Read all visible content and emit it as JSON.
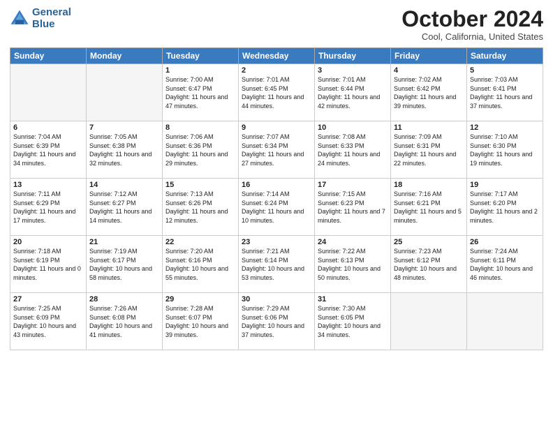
{
  "header": {
    "logo_line1": "General",
    "logo_line2": "Blue",
    "month_title": "October 2024",
    "subtitle": "Cool, California, United States"
  },
  "days_of_week": [
    "Sunday",
    "Monday",
    "Tuesday",
    "Wednesday",
    "Thursday",
    "Friday",
    "Saturday"
  ],
  "weeks": [
    [
      {
        "day": "",
        "sunrise": "",
        "sunset": "",
        "daylight": "",
        "empty": true
      },
      {
        "day": "",
        "sunrise": "",
        "sunset": "",
        "daylight": "",
        "empty": true
      },
      {
        "day": "1",
        "sunrise": "Sunrise: 7:00 AM",
        "sunset": "Sunset: 6:47 PM",
        "daylight": "Daylight: 11 hours and 47 minutes.",
        "empty": false
      },
      {
        "day": "2",
        "sunrise": "Sunrise: 7:01 AM",
        "sunset": "Sunset: 6:45 PM",
        "daylight": "Daylight: 11 hours and 44 minutes.",
        "empty": false
      },
      {
        "day": "3",
        "sunrise": "Sunrise: 7:01 AM",
        "sunset": "Sunset: 6:44 PM",
        "daylight": "Daylight: 11 hours and 42 minutes.",
        "empty": false
      },
      {
        "day": "4",
        "sunrise": "Sunrise: 7:02 AM",
        "sunset": "Sunset: 6:42 PM",
        "daylight": "Daylight: 11 hours and 39 minutes.",
        "empty": false
      },
      {
        "day": "5",
        "sunrise": "Sunrise: 7:03 AM",
        "sunset": "Sunset: 6:41 PM",
        "daylight": "Daylight: 11 hours and 37 minutes.",
        "empty": false
      }
    ],
    [
      {
        "day": "6",
        "sunrise": "Sunrise: 7:04 AM",
        "sunset": "Sunset: 6:39 PM",
        "daylight": "Daylight: 11 hours and 34 minutes.",
        "empty": false
      },
      {
        "day": "7",
        "sunrise": "Sunrise: 7:05 AM",
        "sunset": "Sunset: 6:38 PM",
        "daylight": "Daylight: 11 hours and 32 minutes.",
        "empty": false
      },
      {
        "day": "8",
        "sunrise": "Sunrise: 7:06 AM",
        "sunset": "Sunset: 6:36 PM",
        "daylight": "Daylight: 11 hours and 29 minutes.",
        "empty": false
      },
      {
        "day": "9",
        "sunrise": "Sunrise: 7:07 AM",
        "sunset": "Sunset: 6:34 PM",
        "daylight": "Daylight: 11 hours and 27 minutes.",
        "empty": false
      },
      {
        "day": "10",
        "sunrise": "Sunrise: 7:08 AM",
        "sunset": "Sunset: 6:33 PM",
        "daylight": "Daylight: 11 hours and 24 minutes.",
        "empty": false
      },
      {
        "day": "11",
        "sunrise": "Sunrise: 7:09 AM",
        "sunset": "Sunset: 6:31 PM",
        "daylight": "Daylight: 11 hours and 22 minutes.",
        "empty": false
      },
      {
        "day": "12",
        "sunrise": "Sunrise: 7:10 AM",
        "sunset": "Sunset: 6:30 PM",
        "daylight": "Daylight: 11 hours and 19 minutes.",
        "empty": false
      }
    ],
    [
      {
        "day": "13",
        "sunrise": "Sunrise: 7:11 AM",
        "sunset": "Sunset: 6:29 PM",
        "daylight": "Daylight: 11 hours and 17 minutes.",
        "empty": false
      },
      {
        "day": "14",
        "sunrise": "Sunrise: 7:12 AM",
        "sunset": "Sunset: 6:27 PM",
        "daylight": "Daylight: 11 hours and 14 minutes.",
        "empty": false
      },
      {
        "day": "15",
        "sunrise": "Sunrise: 7:13 AM",
        "sunset": "Sunset: 6:26 PM",
        "daylight": "Daylight: 11 hours and 12 minutes.",
        "empty": false
      },
      {
        "day": "16",
        "sunrise": "Sunrise: 7:14 AM",
        "sunset": "Sunset: 6:24 PM",
        "daylight": "Daylight: 11 hours and 10 minutes.",
        "empty": false
      },
      {
        "day": "17",
        "sunrise": "Sunrise: 7:15 AM",
        "sunset": "Sunset: 6:23 PM",
        "daylight": "Daylight: 11 hours and 7 minutes.",
        "empty": false
      },
      {
        "day": "18",
        "sunrise": "Sunrise: 7:16 AM",
        "sunset": "Sunset: 6:21 PM",
        "daylight": "Daylight: 11 hours and 5 minutes.",
        "empty": false
      },
      {
        "day": "19",
        "sunrise": "Sunrise: 7:17 AM",
        "sunset": "Sunset: 6:20 PM",
        "daylight": "Daylight: 11 hours and 2 minutes.",
        "empty": false
      }
    ],
    [
      {
        "day": "20",
        "sunrise": "Sunrise: 7:18 AM",
        "sunset": "Sunset: 6:19 PM",
        "daylight": "Daylight: 11 hours and 0 minutes.",
        "empty": false
      },
      {
        "day": "21",
        "sunrise": "Sunrise: 7:19 AM",
        "sunset": "Sunset: 6:17 PM",
        "daylight": "Daylight: 10 hours and 58 minutes.",
        "empty": false
      },
      {
        "day": "22",
        "sunrise": "Sunrise: 7:20 AM",
        "sunset": "Sunset: 6:16 PM",
        "daylight": "Daylight: 10 hours and 55 minutes.",
        "empty": false
      },
      {
        "day": "23",
        "sunrise": "Sunrise: 7:21 AM",
        "sunset": "Sunset: 6:14 PM",
        "daylight": "Daylight: 10 hours and 53 minutes.",
        "empty": false
      },
      {
        "day": "24",
        "sunrise": "Sunrise: 7:22 AM",
        "sunset": "Sunset: 6:13 PM",
        "daylight": "Daylight: 10 hours and 50 minutes.",
        "empty": false
      },
      {
        "day": "25",
        "sunrise": "Sunrise: 7:23 AM",
        "sunset": "Sunset: 6:12 PM",
        "daylight": "Daylight: 10 hours and 48 minutes.",
        "empty": false
      },
      {
        "day": "26",
        "sunrise": "Sunrise: 7:24 AM",
        "sunset": "Sunset: 6:11 PM",
        "daylight": "Daylight: 10 hours and 46 minutes.",
        "empty": false
      }
    ],
    [
      {
        "day": "27",
        "sunrise": "Sunrise: 7:25 AM",
        "sunset": "Sunset: 6:09 PM",
        "daylight": "Daylight: 10 hours and 43 minutes.",
        "empty": false
      },
      {
        "day": "28",
        "sunrise": "Sunrise: 7:26 AM",
        "sunset": "Sunset: 6:08 PM",
        "daylight": "Daylight: 10 hours and 41 minutes.",
        "empty": false
      },
      {
        "day": "29",
        "sunrise": "Sunrise: 7:28 AM",
        "sunset": "Sunset: 6:07 PM",
        "daylight": "Daylight: 10 hours and 39 minutes.",
        "empty": false
      },
      {
        "day": "30",
        "sunrise": "Sunrise: 7:29 AM",
        "sunset": "Sunset: 6:06 PM",
        "daylight": "Daylight: 10 hours and 37 minutes.",
        "empty": false
      },
      {
        "day": "31",
        "sunrise": "Sunrise: 7:30 AM",
        "sunset": "Sunset: 6:05 PM",
        "daylight": "Daylight: 10 hours and 34 minutes.",
        "empty": false
      },
      {
        "day": "",
        "sunrise": "",
        "sunset": "",
        "daylight": "",
        "empty": true
      },
      {
        "day": "",
        "sunrise": "",
        "sunset": "",
        "daylight": "",
        "empty": true
      }
    ]
  ]
}
